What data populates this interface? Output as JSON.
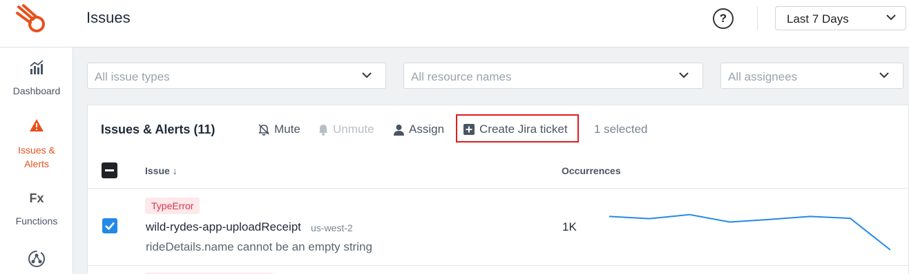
{
  "header": {
    "title": "Issues",
    "help_label": "?",
    "time_range": "Last 7 Days"
  },
  "sidebar": {
    "items": [
      {
        "label": "Dashboard",
        "icon": "chart-icon"
      },
      {
        "label": "Issues &\nAlerts",
        "label_line1": "Issues &",
        "label_line2": "Alerts",
        "icon": "warning-icon",
        "active": true
      },
      {
        "label": "Functions",
        "icon": "fx-icon",
        "icon_text": "Fx"
      },
      {
        "label": "",
        "icon": "graph-icon"
      }
    ]
  },
  "filters": {
    "issue_types": "All issue types",
    "resource_names": "All resource names",
    "assignees": "All assignees"
  },
  "card": {
    "title": "Issues & Alerts (11)",
    "toolbar": {
      "mute": "Mute",
      "unmute": "Unmute",
      "assign": "Assign",
      "create_jira": "Create Jira ticket",
      "selected": "1 selected"
    },
    "columns": {
      "issue": "Issue ↓",
      "occurrences": "Occurrences"
    },
    "rows": [
      {
        "checked": true,
        "tag": "TypeError",
        "name": "wild-rydes-app-uploadReceipt",
        "region": "us-west-2",
        "message": "rideDetails.name cannot be an empty string",
        "occurrences": "1K",
        "sparkline": [
          0.9,
          0.84,
          0.95,
          0.75,
          0.82,
          0.9,
          0.85,
          0.0
        ]
      }
    ]
  },
  "colors": {
    "accent": "#e8511c",
    "checkbox": "#2389e8",
    "highlight_box": "#e01b1b",
    "sparkline": "#2389e8",
    "tag_bg": "#fde8ea",
    "tag_text": "#d9344f"
  }
}
